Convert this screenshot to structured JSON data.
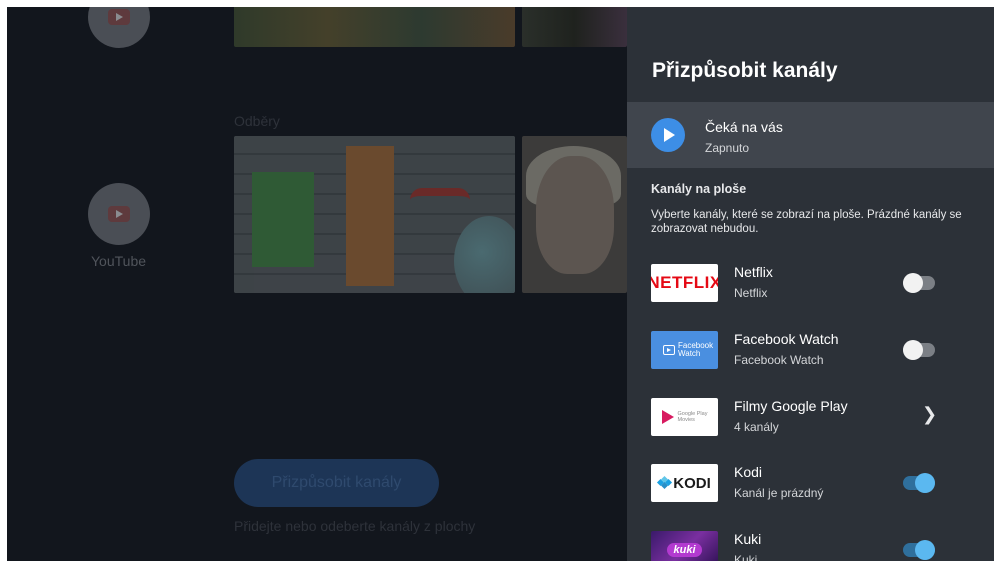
{
  "home": {
    "app_label": "YouTube",
    "section_title": "Odběry",
    "cta_button": "Přizpůsobit kanály",
    "cta_hint": "Přidejte nebo odeberte kanály z plochy"
  },
  "panel": {
    "title": "Přizpůsobit kanály",
    "waiting": {
      "title": "Čeká na vás",
      "status": "Zapnuto"
    },
    "section_label": "Kanály na ploše",
    "section_description": "Vyberte kanály, které se zobrazí na ploše. Prázdné kanály se zobrazovat nebudou.",
    "channels": [
      {
        "logo_text": "NETFLIX",
        "name": "Netflix",
        "subtitle": "Netflix",
        "control": "toggle",
        "enabled": false
      },
      {
        "logo_text": "Facebook Watch",
        "name": "Facebook Watch",
        "subtitle": "Facebook Watch",
        "control": "toggle",
        "enabled": false
      },
      {
        "logo_text": "Google Play Movies",
        "name": "Filmy Google Play",
        "subtitle": "4 kanály",
        "control": "chevron"
      },
      {
        "logo_text": "KODI",
        "name": "Kodi",
        "subtitle": "Kanál je prázdný",
        "control": "toggle",
        "enabled": true
      },
      {
        "logo_text": "kuki",
        "name": "Kuki",
        "subtitle": "Kuki",
        "control": "toggle",
        "enabled": true
      }
    ]
  },
  "colors": {
    "panel_bg": "#2c3138",
    "highlight_row": "#40454d",
    "accent_blue": "#3d8ee6",
    "toggle_on": "#5bb8f0",
    "netflix_red": "#e50914"
  },
  "icons": {
    "play": "play-icon",
    "chevron": "chevron-right-icon",
    "youtube": "youtube-icon"
  }
}
